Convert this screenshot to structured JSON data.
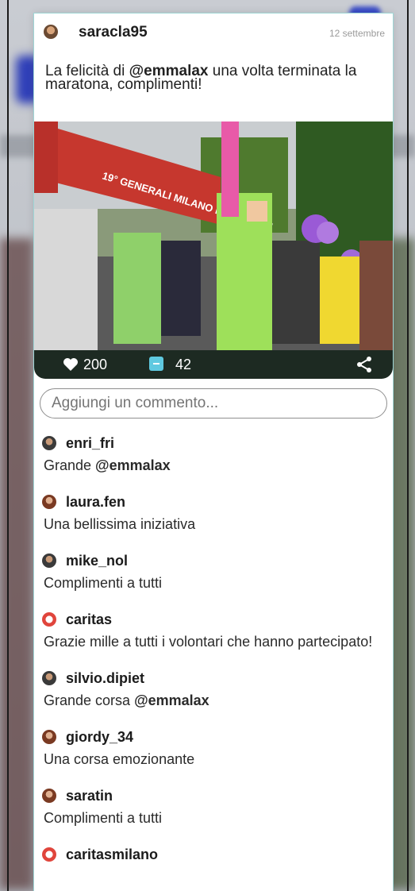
{
  "post": {
    "username": "saracla95",
    "date": "12 settembre",
    "caption_before": "La felicità di ",
    "caption_mention": "@emmalax",
    "caption_after": " una volta terminata la maratona, complimenti!",
    "banner_text": "19° GENERALI MILANO MARATHON",
    "likes": "200",
    "comments": "42"
  },
  "comment_input": {
    "placeholder": "Aggiungi un commento..."
  },
  "comments": [
    {
      "user": "enri_fri",
      "text": "Grande ",
      "mention": "@emmalax",
      "avatar": "man-avatar"
    },
    {
      "user": "laura.fen",
      "text": "Una bellissima iniziativa",
      "mention": "",
      "avatar": "woman-avatar"
    },
    {
      "user": "mike_nol",
      "text": "Complimenti a tutti",
      "mention": "",
      "avatar": "man-avatar"
    },
    {
      "user": "caritas",
      "text": "Grazie mille a tutti i volontari che hanno partecipato!",
      "mention": "",
      "avatar": "caritas-logo"
    },
    {
      "user": "silvio.dipiet",
      "text": "Grande corsa ",
      "mention": "@emmalax",
      "avatar": "man-avatar"
    },
    {
      "user": "giordy_34",
      "text": "Una corsa emozionante",
      "mention": "",
      "avatar": "woman-avatar"
    },
    {
      "user": "saratin",
      "text": "Complimenti a tutti",
      "mention": "",
      "avatar": "woman-avatar"
    },
    {
      "user": "caritasmilano",
      "text": "",
      "mention": "",
      "avatar": "caritas-logo"
    }
  ],
  "colors": {
    "stats_bar": "#1d2a22",
    "comment_icon": "#5fc9e0",
    "caritas_red": "#e0453c"
  },
  "icons": [
    "heart-icon",
    "comment-icon",
    "share-icon"
  ]
}
